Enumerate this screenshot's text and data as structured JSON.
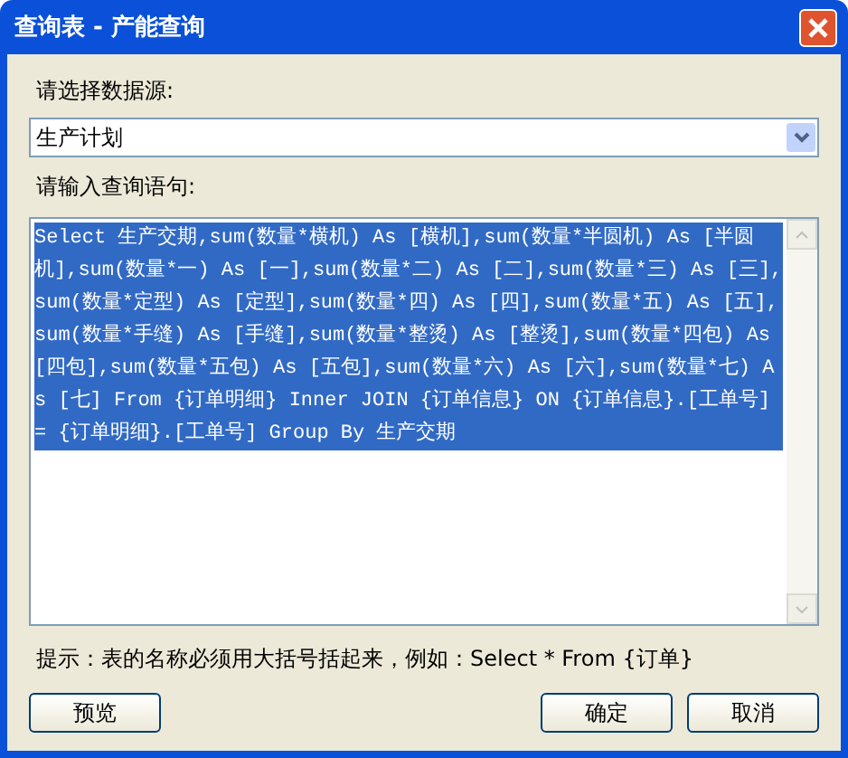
{
  "window": {
    "title": "查询表 - 产能查询"
  },
  "source": {
    "label": "请选择数据源:",
    "value": "生产计划"
  },
  "query": {
    "label": "请输入查询语句:",
    "value": "Select  生产交期,sum(数量*横机) As [横机],sum(数量*半圆机) As [半圆机],sum(数量*一) As [一],sum(数量*二) As [二],sum(数量*三) As [三],sum(数量*定型) As [定型],sum(数量*四) As [四],sum(数量*五) As [五],sum(数量*手缝) As [手缝],sum(数量*整烫) As [整烫],sum(数量*四包) As [四包],sum(数量*五包) As [五包],sum(数量*六) As [六],sum(数量*七) As [七] From {订单明细} Inner JOIN {订单信息} ON {订单信息}.[工单号] = {订单明细}.[工单号] Group By 生产交期",
    "selected": true
  },
  "hint": "提示：表的名称必须用大括号括起来，例如：Select * From {订单}",
  "buttons": [
    {
      "label": "预览",
      "kind": "left"
    },
    {
      "label": "确定",
      "kind": "right"
    },
    {
      "label": "取消",
      "kind": "right"
    }
  ]
}
